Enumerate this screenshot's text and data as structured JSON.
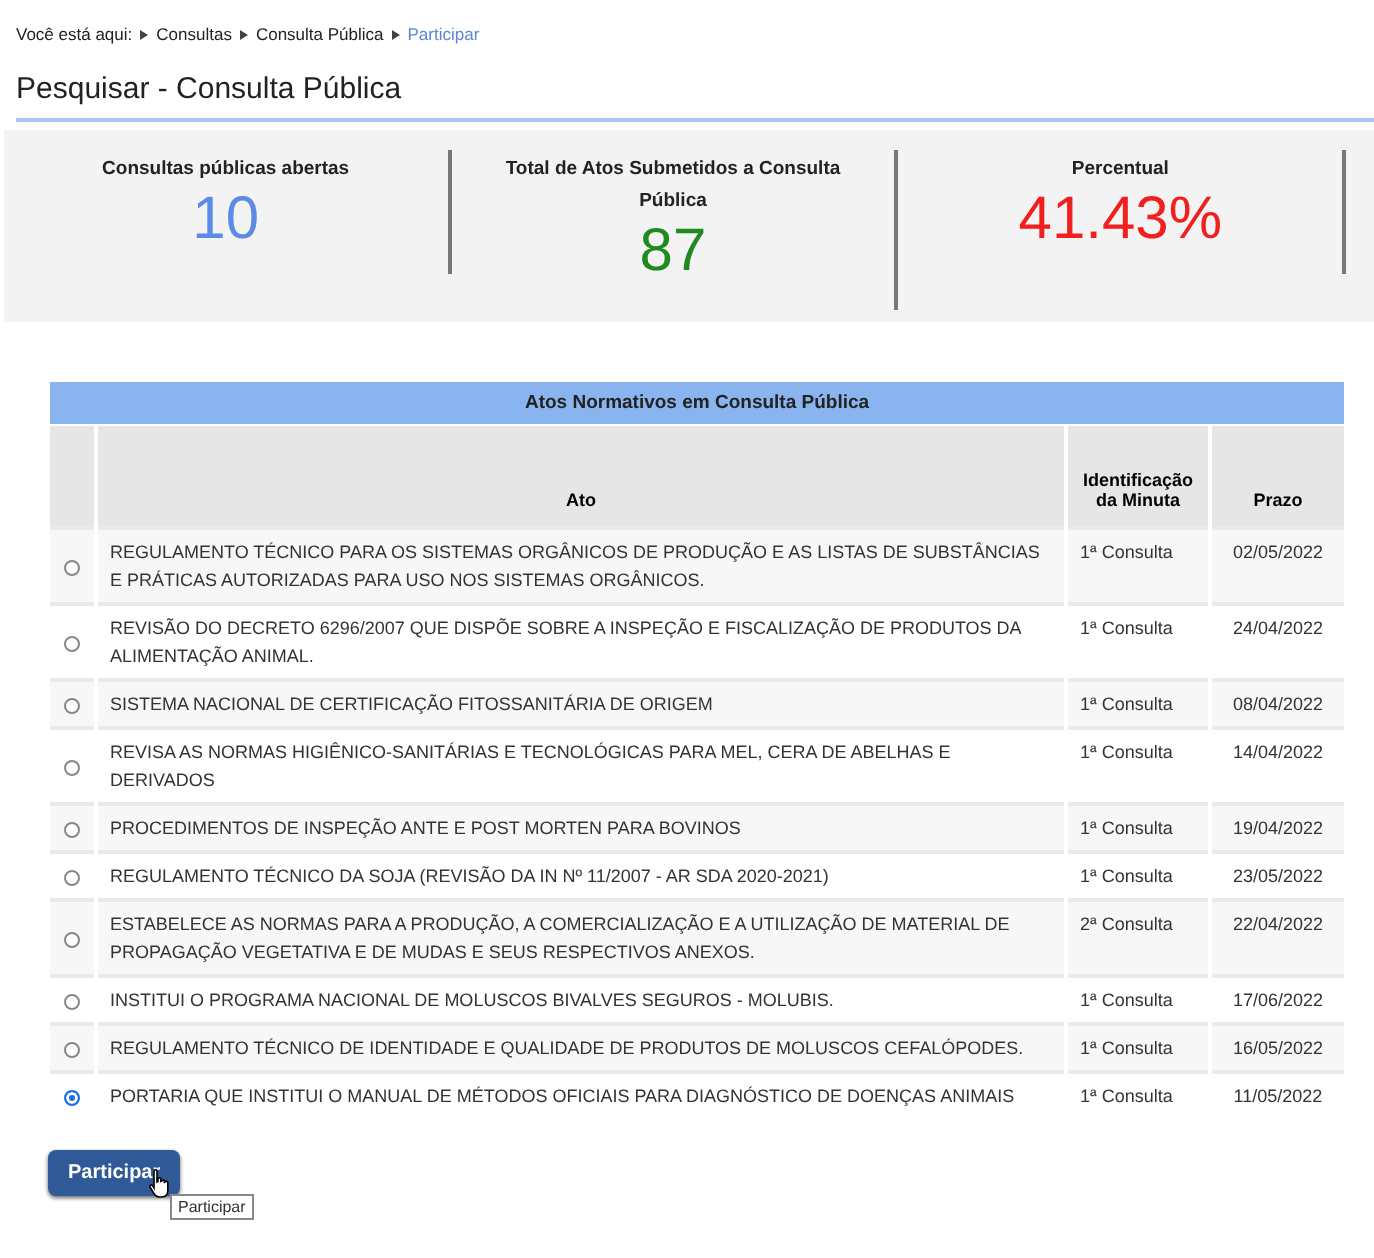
{
  "breadcrumb": [
    {
      "label": "Você está aqui:",
      "kind": "prefix"
    },
    {
      "label": "Consultas",
      "kind": "link"
    },
    {
      "label": "Consulta Pública",
      "kind": "link"
    },
    {
      "label": "Participar",
      "kind": "current"
    }
  ],
  "page_title": "Pesquisar - Consulta Pública",
  "stats": [
    {
      "label": "Consultas públicas abertas",
      "value": "10",
      "color": "#5b8be6"
    },
    {
      "label": "Total de Atos Submetidos a Consulta Pública",
      "value": "87",
      "color": "#1f8a1f"
    },
    {
      "label": "Percentual",
      "value": "41.43%",
      "color": "#f02020"
    }
  ],
  "table": {
    "title": "Atos Normativos em Consulta Pública",
    "columns": [
      "Ato",
      "Identificação da Minuta",
      "Prazo"
    ],
    "rows": [
      {
        "ato": "REGULAMENTO TÉCNICO PARA OS SISTEMAS ORGÂNICOS DE PRODUÇÃO E AS LISTAS DE SUBSTÂNCIAS E PRÁTICAS AUTORIZADAS PARA USO NOS SISTEMAS ORGÂNICOS.",
        "minuta": "1ª Consulta",
        "prazo": "02/05/2022",
        "selected": false
      },
      {
        "ato": "REVISÃO DO DECRETO 6296/2007 QUE DISPÕE SOBRE A INSPEÇÃO E FISCALIZAÇÃO DE PRODUTOS DA ALIMENTAÇÃO ANIMAL.",
        "minuta": "1ª Consulta",
        "prazo": "24/04/2022",
        "selected": false
      },
      {
        "ato": "SISTEMA NACIONAL DE CERTIFICAÇÃO FITOSSANITÁRIA DE ORIGEM",
        "minuta": "1ª Consulta",
        "prazo": "08/04/2022",
        "selected": false
      },
      {
        "ato": "REVISA AS NORMAS HIGIÊNICO-SANITÁRIAS E TECNOLÓGICAS PARA MEL, CERA DE ABELHAS E DERIVADOS",
        "minuta": "1ª Consulta",
        "prazo": "14/04/2022",
        "selected": false
      },
      {
        "ato": "PROCEDIMENTOS DE INSPEÇÃO ANTE E POST MORTEN PARA BOVINOS",
        "minuta": "1ª Consulta",
        "prazo": "19/04/2022",
        "selected": false
      },
      {
        "ato": "REGULAMENTO TÉCNICO DA SOJA (REVISÃO DA IN Nº 11/2007 - AR SDA 2020-2021)",
        "minuta": "1ª Consulta",
        "prazo": "23/05/2022",
        "selected": false
      },
      {
        "ato": "ESTABELECE AS NORMAS PARA A PRODUÇÃO, A COMERCIALIZAÇÃO E A UTILIZAÇÃO DE MATERIAL DE PROPAGAÇÃO VEGETATIVA E DE MUDAS E SEUS RESPECTIVOS ANEXOS.",
        "minuta": "2ª Consulta",
        "prazo": "22/04/2022",
        "selected": false
      },
      {
        "ato": "INSTITUI O PROGRAMA NACIONAL DE MOLUSCOS BIVALVES SEGUROS - MOLUBIS.",
        "minuta": "1ª Consulta",
        "prazo": "17/06/2022",
        "selected": false
      },
      {
        "ato": "REGULAMENTO TÉCNICO DE IDENTIDADE E QUALIDADE DE PRODUTOS DE MOLUSCOS CEFALÓPODES.",
        "minuta": "1ª Consulta",
        "prazo": "16/05/2022",
        "selected": false
      },
      {
        "ato": "PORTARIA QUE INSTITUI O MANUAL DE MÉTODOS OFICIAIS PARA DIAGNÓSTICO DE DOENÇAS ANIMAIS",
        "minuta": "1ª Consulta",
        "prazo": "11/05/2022",
        "selected": true
      }
    ]
  },
  "submit_button": "Participar",
  "tooltip": "Participar"
}
